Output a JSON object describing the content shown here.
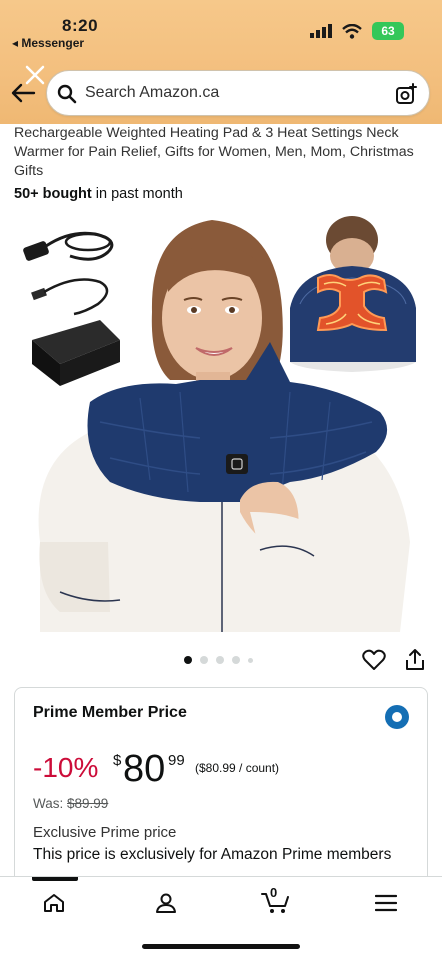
{
  "status": {
    "time": "8:20",
    "back_app": "◂ Messenger",
    "battery": "63"
  },
  "search": {
    "placeholder": "Search Amazon.ca"
  },
  "product": {
    "title": "Rechargeable Weighted Heating Pad & 3 Heat Settings Neck Warmer for Pain Relief, Gifts for Women, Men, Mom, Christmas Gifts",
    "bought_bold": "50+ bought",
    "bought_rest": " in past month",
    "image_count": 5,
    "image_index": 1
  },
  "price_card": {
    "title": "Prime Member Price",
    "discount": "-10%",
    "currency": "$",
    "whole": "80",
    "fraction": "99",
    "unit_price": "($80.99 / count)",
    "was_label": "Was:",
    "was_price": "$89.99",
    "exclusive_title": "Exclusive Prime price",
    "exclusive_desc": "This price is exclusively for Amazon Prime members"
  },
  "nav": {
    "cart_count": "0",
    "items": [
      "home-icon",
      "account-icon",
      "cart-icon",
      "menu-icon"
    ]
  },
  "colors": {
    "header": "#f3bf7e",
    "discount": "#cc0c39",
    "radio": "#146eb4",
    "pad": "#1f3a6e"
  }
}
